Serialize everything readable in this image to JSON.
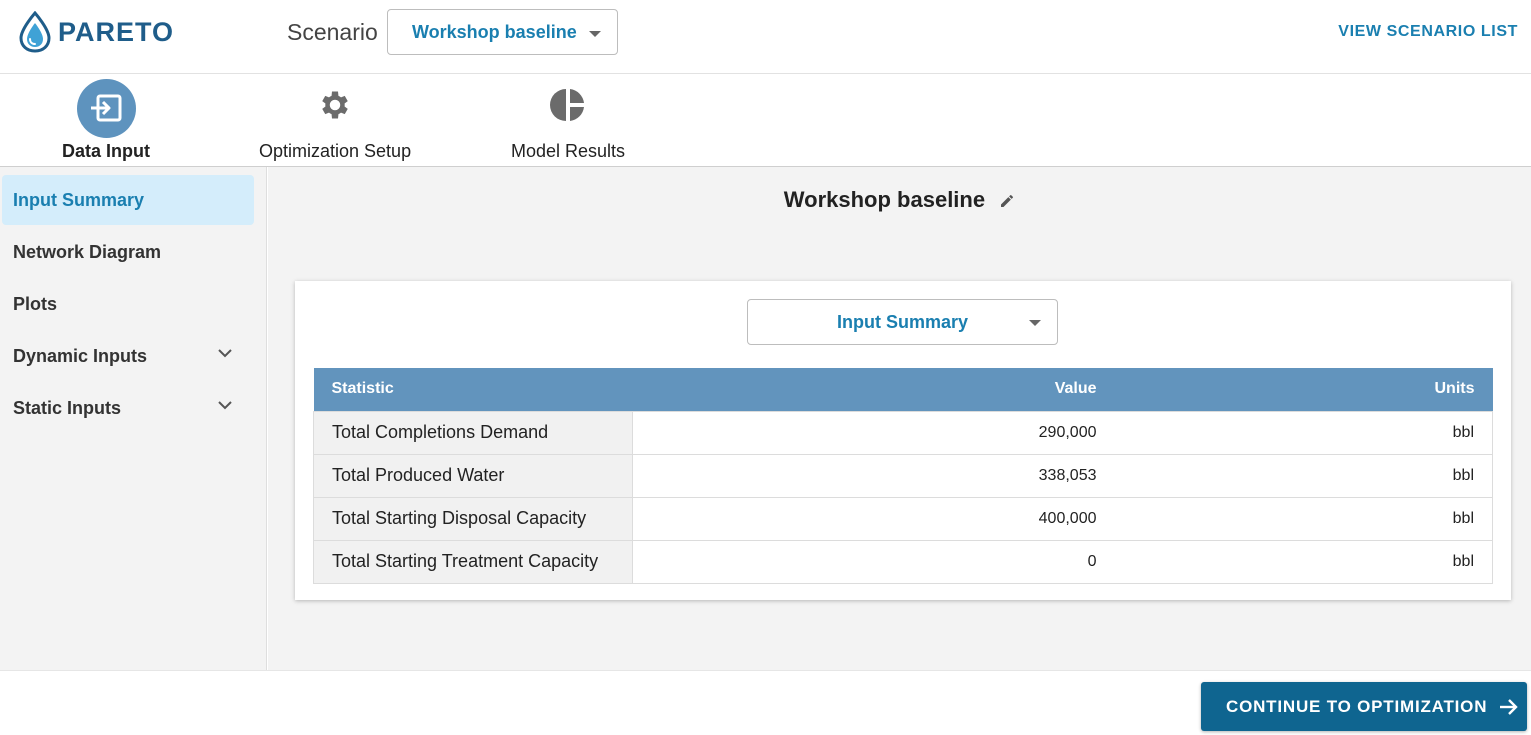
{
  "app": {
    "logo_text": "PARETO"
  },
  "header": {
    "scenario_label": "Scenario",
    "scenario_selected": "Workshop baseline",
    "view_list_label": "VIEW SCENARIO LIST"
  },
  "tabs": [
    {
      "label": "Data Input",
      "icon": "data-input-icon",
      "active": true
    },
    {
      "label": "Optimization Setup",
      "icon": "gear-icon",
      "active": false
    },
    {
      "label": "Model Results",
      "icon": "pie-chart-icon",
      "active": false
    }
  ],
  "sidebar": {
    "items": [
      {
        "label": "Input Summary",
        "active": true
      },
      {
        "label": "Network Diagram"
      },
      {
        "label": "Plots"
      },
      {
        "label": "Dynamic Inputs",
        "expandable": true
      },
      {
        "label": "Static Inputs",
        "expandable": true
      }
    ]
  },
  "main": {
    "title": "Workshop baseline",
    "view_selected": "Input Summary",
    "table": {
      "headers": {
        "statistic": "Statistic",
        "value": "Value",
        "units": "Units"
      },
      "rows": [
        {
          "statistic": "Total Completions Demand",
          "value": "290,000",
          "units": "bbl"
        },
        {
          "statistic": "Total Produced Water",
          "value": "338,053",
          "units": "bbl"
        },
        {
          "statistic": "Total Starting Disposal Capacity",
          "value": "400,000",
          "units": "bbl"
        },
        {
          "statistic": "Total Starting Treatment Capacity",
          "value": "0",
          "units": "bbl"
        }
      ]
    }
  },
  "footer": {
    "continue_label": "CONTINUE TO OPTIMIZATION"
  },
  "colors": {
    "accent": "#1a7fb0",
    "table_header": "#6294bd",
    "button": "#0f6590",
    "active_sidebar_bg": "#d4edfb"
  }
}
